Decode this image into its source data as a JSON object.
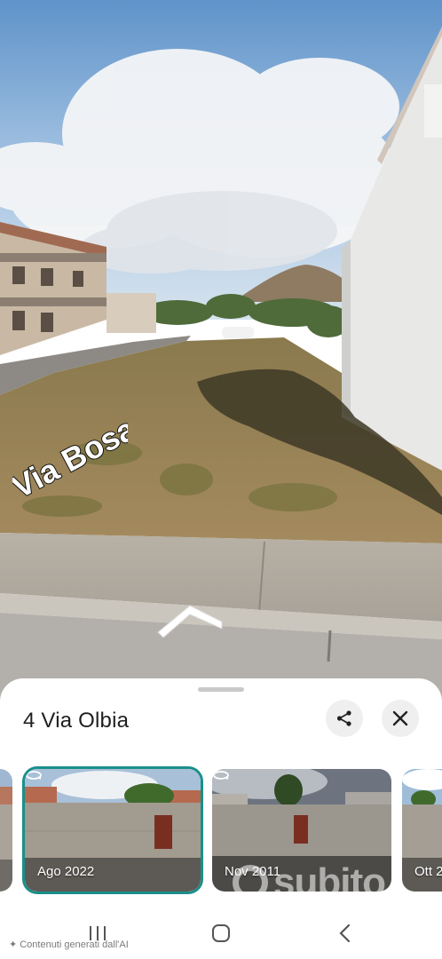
{
  "place": {
    "title": "4 Via Olbia",
    "road_label": "Via Bosa"
  },
  "actions": {
    "share_icon": "share-icon",
    "close_icon": "close-icon"
  },
  "history": [
    {
      "label": "",
      "selected": false
    },
    {
      "label": "Ago 2022",
      "selected": true
    },
    {
      "label": "Nov 2011",
      "selected": false
    },
    {
      "label": "Ott 2",
      "selected": false
    }
  ],
  "watermark": {
    "text": "subito"
  },
  "footer": {
    "ai_note": "Contenuti generati dall'AI"
  },
  "colors": {
    "selected_outline": "#1a8f8a",
    "sheet_bg": "#ffffff",
    "button_bg": "#efefef"
  }
}
